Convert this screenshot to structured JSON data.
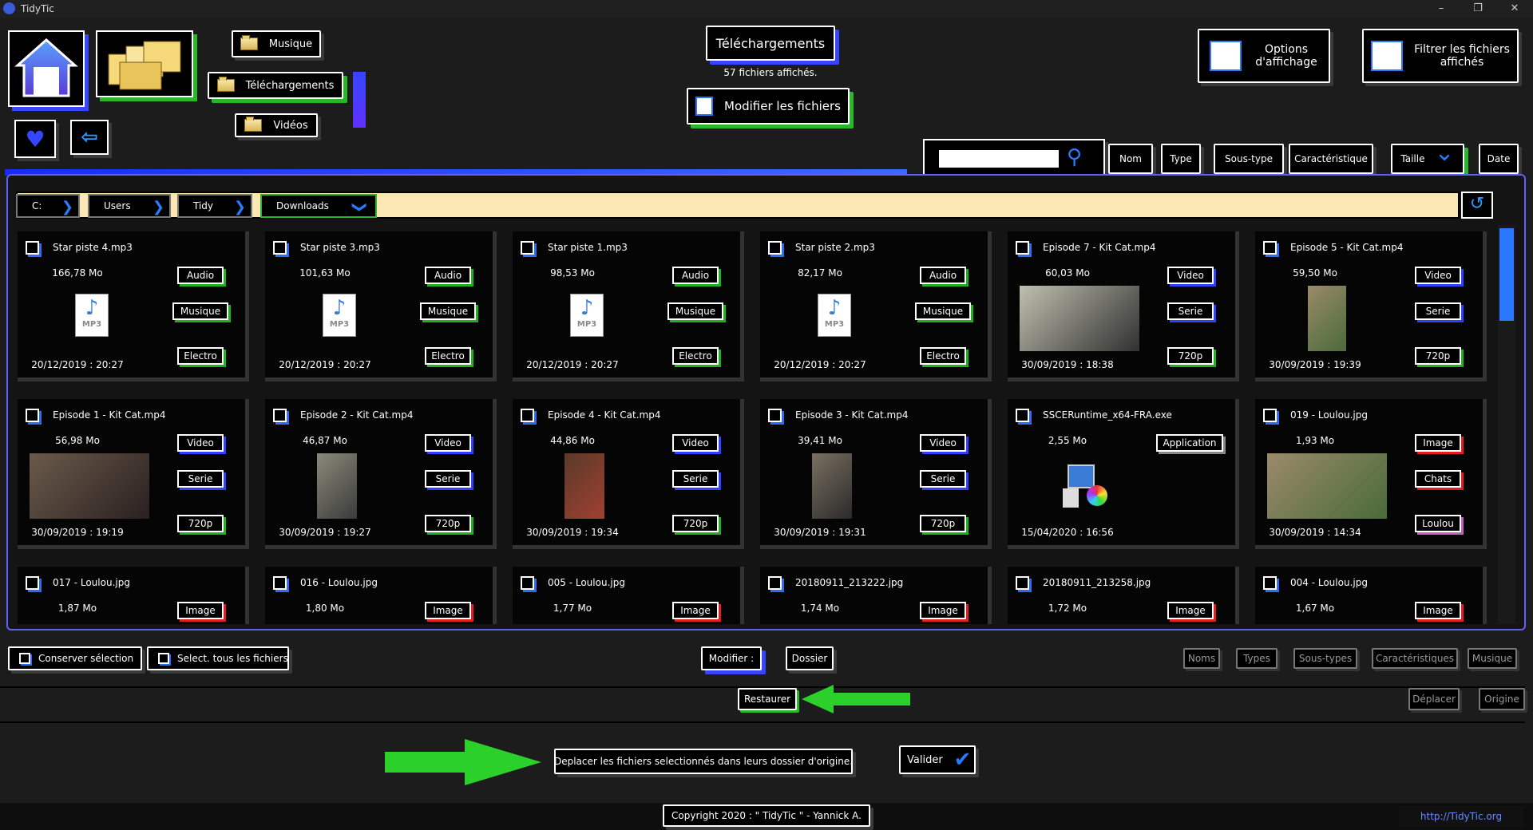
{
  "window": {
    "title": "TidyTic"
  },
  "nav": {
    "quick_folders": [
      {
        "label": "Musique"
      },
      {
        "label": "Téléchargements"
      },
      {
        "label": "Vidéos"
      }
    ]
  },
  "current_folder": {
    "title": "Téléchargements",
    "count_text": "57 fichiers affichés."
  },
  "actions": {
    "modify_files": "Modifier les fichiers",
    "display_options": "Options d'affichage",
    "filter_files": "Filtrer les fichiers affichés"
  },
  "sort_buttons": [
    "Nom",
    "Type",
    "Sous-type",
    "Caractéristique",
    "Taille",
    "Date"
  ],
  "breadcrumb": [
    "C:",
    "Users",
    "Tidy",
    "Downloads"
  ],
  "files": [
    {
      "name": "Star piste 4.mp3",
      "size": "166,78 Mo",
      "date": "20/12/2019 : 20:27",
      "tags": [
        "Audio",
        "Musique",
        "Electro"
      ]
    },
    {
      "name": "Star piste 3.mp3",
      "size": "101,63 Mo",
      "date": "20/12/2019 : 20:27",
      "tags": [
        "Audio",
        "Musique",
        "Electro"
      ]
    },
    {
      "name": "Star piste 1.mp3",
      "size": "98,53 Mo",
      "date": "20/12/2019 : 20:27",
      "tags": [
        "Audio",
        "Musique",
        "Electro"
      ]
    },
    {
      "name": "Star piste 2.mp3",
      "size": "82,17 Mo",
      "date": "20/12/2019 : 20:27",
      "tags": [
        "Audio",
        "Musique",
        "Electro"
      ]
    },
    {
      "name": "Episode 7 - Kit Cat.mp4",
      "size": "60,03 Mo",
      "date": "30/09/2019 : 18:38",
      "tags": [
        "Video",
        "Serie",
        "720p"
      ]
    },
    {
      "name": "Episode 5 - Kit Cat.mp4",
      "size": "59,50 Mo",
      "date": "30/09/2019 : 19:39",
      "tags": [
        "Video",
        "Serie",
        "720p"
      ]
    },
    {
      "name": "Episode 1 - Kit Cat.mp4",
      "size": "56,98 Mo",
      "date": "30/09/2019 : 19:19",
      "tags": [
        "Video",
        "Serie",
        "720p"
      ]
    },
    {
      "name": "Episode 2 - Kit Cat.mp4",
      "size": "46,87 Mo",
      "date": "30/09/2019 : 19:27",
      "tags": [
        "Video",
        "Serie",
        "720p"
      ]
    },
    {
      "name": "Episode 4 - Kit Cat.mp4",
      "size": "44,86 Mo",
      "date": "30/09/2019 : 19:34",
      "tags": [
        "Video",
        "Serie",
        "720p"
      ]
    },
    {
      "name": "Episode 3 - Kit Cat.mp4",
      "size": "39,41 Mo",
      "date": "30/09/2019 : 19:31",
      "tags": [
        "Video",
        "Serie",
        "720p"
      ]
    },
    {
      "name": "SSCERuntime_x64-FRA.exe",
      "size": "2,55 Mo",
      "date": "15/04/2020 : 16:56",
      "tags": [
        "Application"
      ]
    },
    {
      "name": "019 - Loulou.jpg",
      "size": "1,93 Mo",
      "date": "30/09/2019 : 14:34",
      "tags": [
        "Image",
        "Chats",
        "Loulou"
      ]
    },
    {
      "name": "017 - Loulou.jpg",
      "size": "1,87 Mo",
      "date": "",
      "tags": [
        "Image"
      ]
    },
    {
      "name": "016 - Loulou.jpg",
      "size": "1,80 Mo",
      "date": "",
      "tags": [
        "Image"
      ]
    },
    {
      "name": "005 - Loulou.jpg",
      "size": "1,77 Mo",
      "date": "",
      "tags": [
        "Image"
      ]
    },
    {
      "name": "20180911_213222.jpg",
      "size": "1,74 Mo",
      "date": "",
      "tags": [
        "Image"
      ]
    },
    {
      "name": "20180911_213258.jpg",
      "size": "1,72 Mo",
      "date": "",
      "tags": [
        "Image"
      ]
    },
    {
      "name": "004 - Loulou.jpg",
      "size": "1,67 Mo",
      "date": "",
      "tags": [
        "Image"
      ]
    }
  ],
  "bottom": {
    "keep_selection": "Conserver sélection",
    "select_all": "Select. tous les fichiers",
    "modify_label": "Modifier :",
    "folder": "Dossier",
    "right_buttons": [
      "Noms",
      "Types",
      "Sous-types",
      "Caractéristiques",
      "Musique"
    ],
    "restore": "Restaurer",
    "move": "Déplacer",
    "origin": "Origine",
    "description": "Deplacer les fichiers selectionnés dans leurs dossier d'origine.",
    "validate": "Valider"
  },
  "footer": {
    "copyright": "Copyright 2020 : \" TidyTic \" - Yannick A.",
    "link": "http://TidyTic.org"
  },
  "colors": {
    "accent_blue": "#2a78ff",
    "accent_green": "#2bd02b",
    "panel_border": "#6060ff"
  }
}
